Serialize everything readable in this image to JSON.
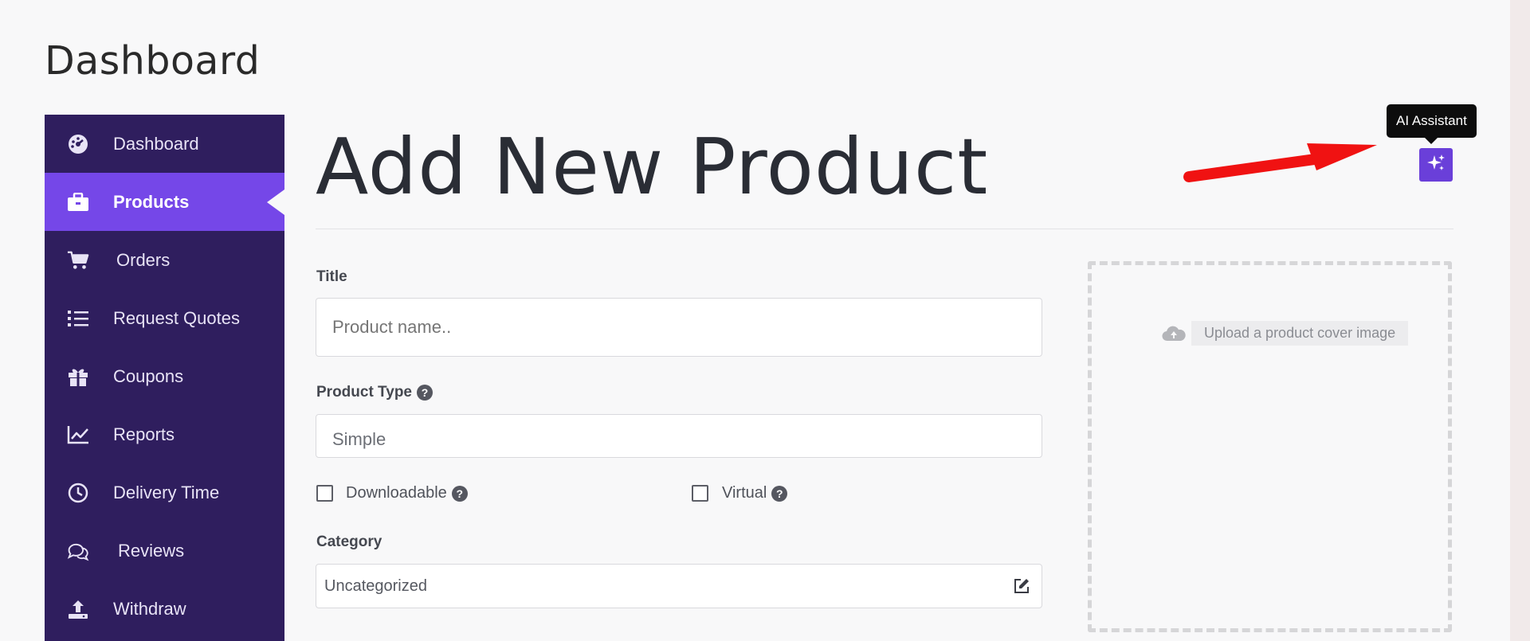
{
  "page": {
    "heading": "Dashboard"
  },
  "sidebar": {
    "items": [
      {
        "label": "Dashboard",
        "icon": "gauge-icon",
        "active": false
      },
      {
        "label": "Products",
        "icon": "briefcase-icon",
        "active": true
      },
      {
        "label": "Orders",
        "icon": "cart-icon",
        "active": false
      },
      {
        "label": "Request Quotes",
        "icon": "list-icon",
        "active": false
      },
      {
        "label": "Coupons",
        "icon": "gift-icon",
        "active": false
      },
      {
        "label": "Reports",
        "icon": "line-chart-icon",
        "active": false
      },
      {
        "label": "Delivery Time",
        "icon": "clock-icon",
        "active": false
      },
      {
        "label": "Reviews",
        "icon": "chat-bubbles-icon",
        "active": false
      },
      {
        "label": "Withdraw",
        "icon": "upload-icon",
        "active": false
      }
    ]
  },
  "main": {
    "title": "Add New Product",
    "ai_tooltip": "AI Assistant",
    "form": {
      "title_label": "Title",
      "title_placeholder": "Product name..",
      "product_type_label": "Product Type",
      "product_type_value": "Simple",
      "downloadable_label": "Downloadable",
      "virtual_label": "Virtual",
      "category_label": "Category",
      "category_value": "Uncategorized",
      "help_glyph": "?"
    },
    "upload": {
      "label": "Upload a product cover image"
    }
  },
  "colors": {
    "sidebar_bg": "#2f1e5e",
    "active_item": "#7547e8",
    "ai_button": "#6a3fd9",
    "annotation_arrow": "#f01212"
  }
}
